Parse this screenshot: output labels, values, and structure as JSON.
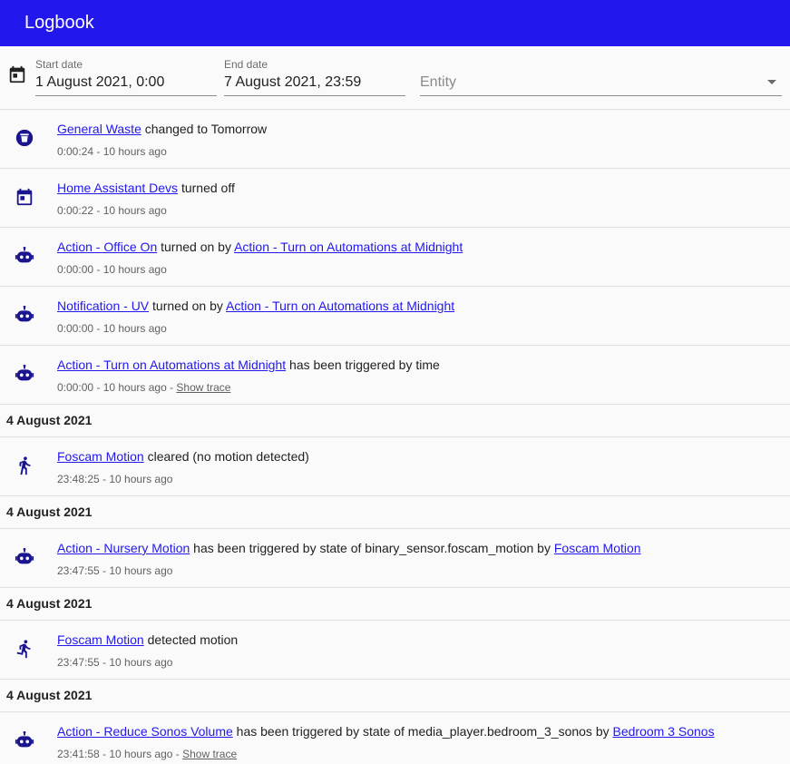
{
  "header": {
    "title": "Logbook"
  },
  "filters": {
    "start_label": "Start date",
    "start_value": "1 August 2021, 0:00",
    "end_label": "End date",
    "end_value": "7 August 2021, 23:59",
    "entity_placeholder": "Entity"
  },
  "entries": [
    {
      "link1": "General Waste",
      "text1": " changed to Tomorrow",
      "time": "0:00:24 - 10 hours ago"
    },
    {
      "link1": "Home Assistant Devs",
      "text1": " turned off",
      "time": "0:00:22 - 10 hours ago"
    },
    {
      "link1": "Action - Office On",
      "text1": " turned on by ",
      "link2": "Action - Turn on Automations at Midnight",
      "time": "0:00:00 - 10 hours ago"
    },
    {
      "link1": "Notification - UV",
      "text1": " turned on by ",
      "link2": "Action - Turn on Automations at Midnight",
      "time": "0:00:00 - 10 hours ago"
    },
    {
      "link1": "Action - Turn on Automations at Midnight",
      "text1": " has been triggered by time",
      "time": "0:00:00 - 10 hours ago - ",
      "trace": "Show trace"
    },
    {
      "date": "4 August 2021"
    },
    {
      "link1": "Foscam Motion",
      "text1": " cleared (no motion detected)",
      "time": "23:48:25 - 10 hours ago"
    },
    {
      "date": "4 August 2021"
    },
    {
      "link1": "Action - Nursery Motion",
      "text1": " has been triggered by state of binary_sensor.foscam_motion by ",
      "link2": "Foscam Motion",
      "time": "23:47:55 - 10 hours ago"
    },
    {
      "date": "4 August 2021"
    },
    {
      "link1": "Foscam Motion",
      "text1": " detected motion",
      "time": "23:47:55 - 10 hours ago"
    },
    {
      "date": "4 August 2021"
    },
    {
      "link1": "Action - Reduce Sonos Volume",
      "text1": " has been triggered by state of media_player.bedroom_3_sonos by ",
      "link2": "Bedroom 3 Sonos",
      "time": "23:41:58 - 10 hours ago - ",
      "trace": "Show trace"
    }
  ],
  "icons": [
    "trash-can-icon",
    "calendar-icon",
    "robot-icon",
    "walk-icon",
    "run-icon"
  ],
  "colors": {
    "accent": "#2218ee",
    "icon": "#1a148f"
  }
}
